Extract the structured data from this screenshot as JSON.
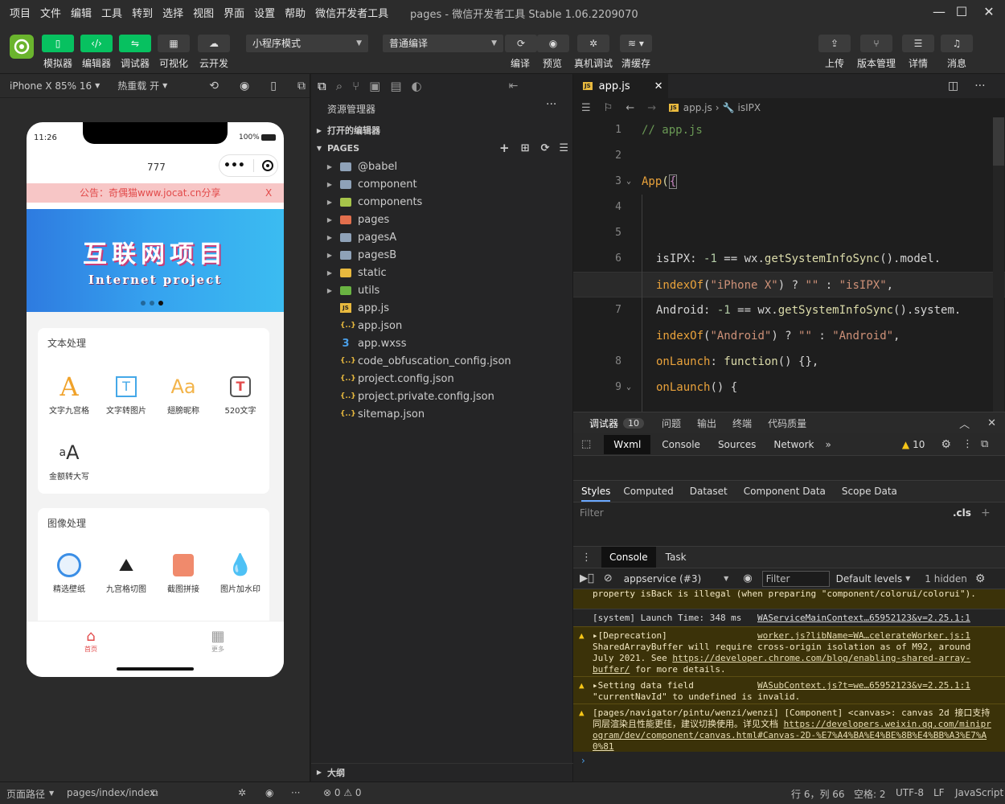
{
  "menu": [
    "项目",
    "文件",
    "编辑",
    "工具",
    "转到",
    "选择",
    "视图",
    "界面",
    "设置",
    "帮助",
    "微信开发者工具"
  ],
  "window_title": "pages - 微信开发者工具 Stable 1.06.2209070",
  "toolbar": {
    "left_buttons": [
      "模拟器",
      "编辑器",
      "调试器",
      "可视化",
      "云开发"
    ],
    "mode_select": "小程序模式",
    "compile_select": "普通编译",
    "mid_buttons": [
      "编译",
      "预览",
      "真机调试",
      "清缓存"
    ],
    "right_buttons": [
      "上传",
      "版本管理",
      "详情",
      "消息"
    ]
  },
  "simulator": {
    "device": "iPhone X 85% 16",
    "hot_reload": "热重载 开",
    "time": "11:26",
    "battery": "100%",
    "nav_title": "777",
    "notice": "公告：奇偶猫www.jocat.cn分享",
    "notice_close": "X",
    "banner_title": "互联网项目",
    "banner_sub": "Internet project",
    "section1_title": "文本处理",
    "section1_items": [
      "文字九宫格",
      "文字转图片",
      "翅膀昵称",
      "520文字",
      "金额转大写"
    ],
    "section2_title": "图像处理",
    "section2_items": [
      "精选壁纸",
      "九宫格切图",
      "截图拼接",
      "图片加水印"
    ],
    "tabs": [
      "首页",
      "更多"
    ]
  },
  "explorer": {
    "title": "资源管理器",
    "open_editors": "打开的编辑器",
    "root": "PAGES",
    "folders": [
      "@babel",
      "component",
      "components",
      "pages",
      "pagesA",
      "pagesB",
      "static",
      "utils"
    ],
    "files": [
      "app.js",
      "app.json",
      "app.wxss",
      "code_obfuscation_config.json",
      "project.config.json",
      "project.private.config.json",
      "sitemap.json"
    ],
    "outline": "大纲"
  },
  "editor": {
    "tab": "app.js",
    "breadcrumb_file": "app.js",
    "breadcrumb_symbol": "isIPX",
    "line_numbers": [
      "1",
      "2",
      "3",
      "4",
      "5",
      "6",
      "",
      "7",
      "",
      "8",
      "9"
    ]
  },
  "debugger": {
    "top_tabs": [
      "调试器",
      "问题",
      "输出",
      "终端",
      "代码质量"
    ],
    "badge": "10",
    "dev_tabs": [
      "Wxml",
      "Console",
      "Sources",
      "Network"
    ],
    "warn_count": "10",
    "style_tabs": [
      "Styles",
      "Computed",
      "Dataset",
      "Component Data",
      "Scope Data"
    ],
    "filter": "Filter",
    "cls": ".cls",
    "console_tabs": [
      "Console",
      "Task"
    ],
    "context": "appservice (#3)",
    "filter_placeholder": "Filter",
    "levels": "Default levels",
    "hidden": "1 hidden",
    "messages": {
      "m0": "property isBack is illegal (when preparing \"component/colorui/colorui\").",
      "m1_text": "[system] Launch Time: 348 ms",
      "m1_link": "WAServiceMainContext…65952123&v=2.25.1:1",
      "m2_head": "▸[Deprecation]",
      "m2_link": "worker.js?libName=WA…celerateWorker.js:1",
      "m2_body": "SharedArrayBuffer will require cross-origin isolation as of M92, around July 2021. See",
      "m2_url": "https://developer.chrome.com/blog/enabling-shared-array-buffer/",
      "m2_tail": "for more details.",
      "m3_head": "▸Setting data field",
      "m3_link": "WASubContext.js?t=we…65952123&v=2.25.1:1",
      "m3_body": "\"currentNavId\" to undefined is invalid.",
      "m4_body": "[pages/navigator/pintu/wenzi/wenzi] [Component] <canvas>: canvas 2d 接口支持同层渲染且性能更佳，建议切换使用。详见文档",
      "m4_url": "https://developers.weixin.qq.com/miniprogram/dev/component/canvas.html#Canvas-2D-%E7%A4%BA%E4%BE%8B%E4%BB%A3%E7%A0%81"
    }
  },
  "status": {
    "page_path_label": "页面路径",
    "page_path": "pages/index/index",
    "errors": "⊗ 0 ⚠ 0",
    "cursor": "行 6，列 66",
    "spaces": "空格: 2",
    "encoding": "UTF-8",
    "eol": "LF",
    "language": "JavaScript"
  }
}
